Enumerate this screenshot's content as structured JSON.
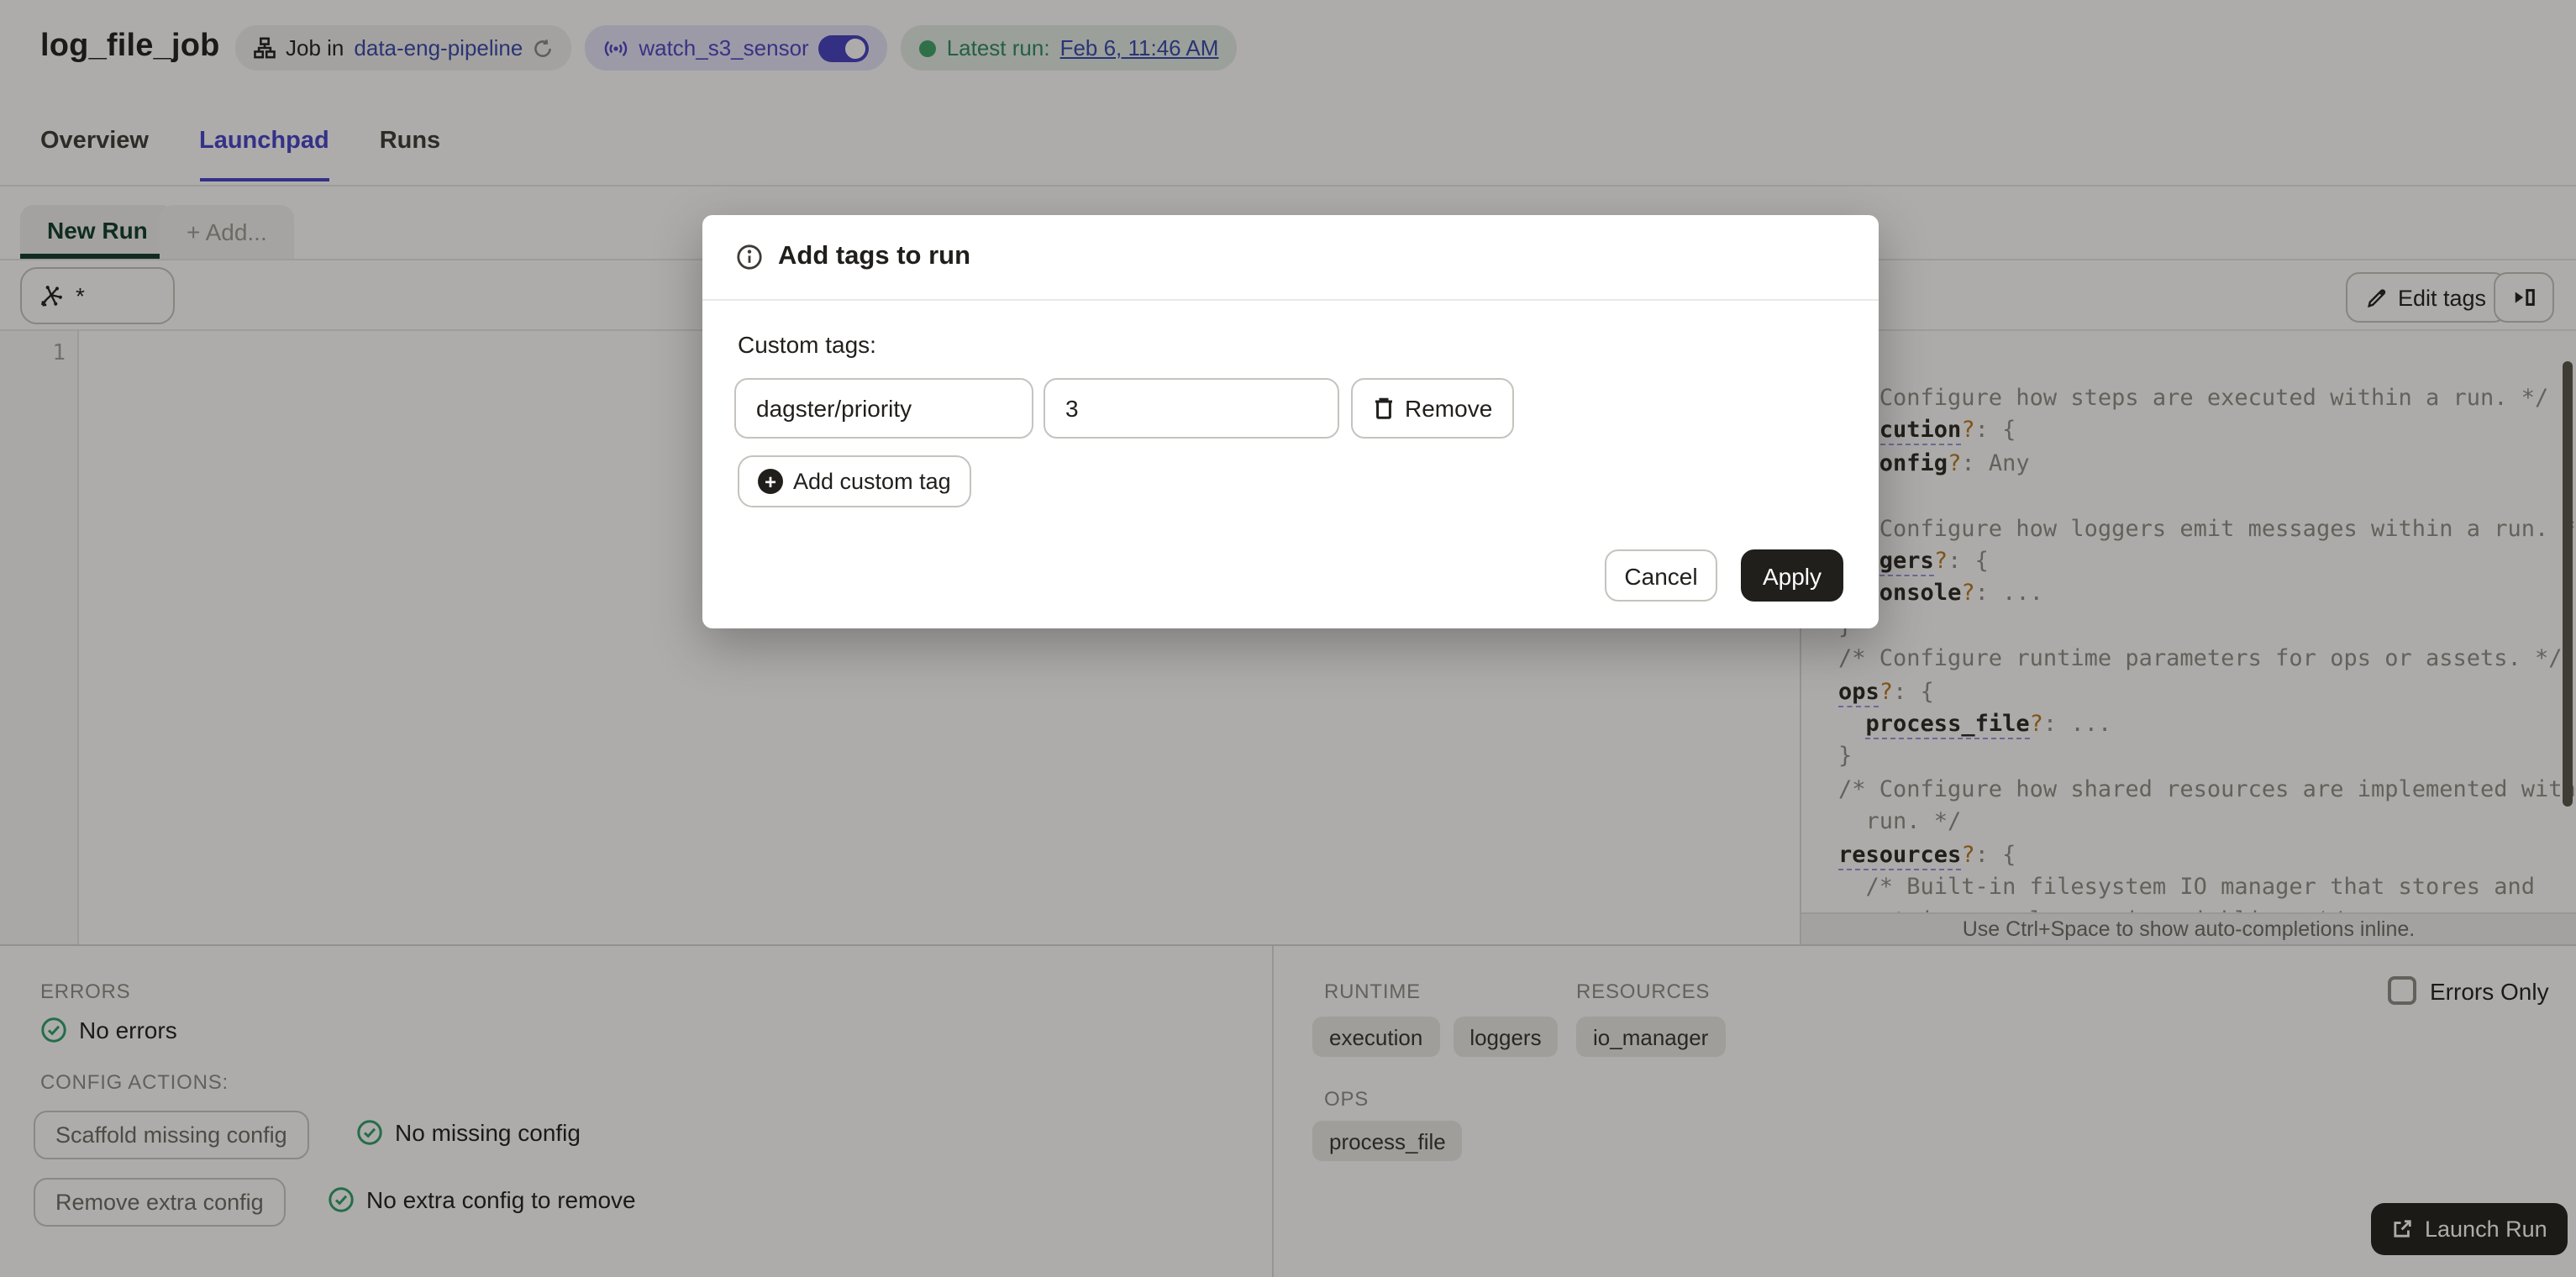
{
  "colors": {
    "accent_blue": "#4642C8",
    "link_blue": "#3647AD",
    "badge_sensor_bg": "#E6E3FA",
    "badge_sensor_text": "#4945C4",
    "green": "#2E9E68",
    "green_dot": "#3FA469",
    "dark": "#211F1C",
    "dark_green": "#0D3B2A",
    "schema_orange": "#B9771E",
    "schema_gray": "#908D86",
    "overlay": "rgba(20,18,15,0.35)"
  },
  "icons": {
    "job": "job-graph-icon",
    "refresh": "refresh-icon",
    "sensor": "sensor-broadcast-icon",
    "op_selector": "op-selector-icon",
    "edit": "pencil-icon",
    "panel": "collapse-panel-icon",
    "info": "info-icon",
    "trash": "trash-icon",
    "plus": "plus-circle-icon",
    "check": "check-circle-icon",
    "launch": "launch-icon"
  },
  "header": {
    "title": "log_file_job",
    "job_badge": {
      "prefix": "Job in",
      "repo_link": "data-eng-pipeline"
    },
    "sensor_badge": {
      "label": "watch_s3_sensor",
      "toggle_on": true
    },
    "latest_run_badge": {
      "label": "Latest run:",
      "value": "Feb 6, 11:46 AM"
    }
  },
  "tabs": {
    "overview": "Overview",
    "launchpad": "Launchpad",
    "runs": "Runs"
  },
  "launchpad": {
    "new_run_tab": "New Run",
    "add_tab": "+ Add...",
    "op_selector_value": "*",
    "edit_tags_button": "Edit tags",
    "editor": {
      "line_number": "1"
    },
    "hint_bar": "Use Ctrl+Space to show auto-completions inline.",
    "schema": {
      "lines": [
        [
          {
            "s": "c",
            "t": "/* Configure how steps are executed within a run. */"
          }
        ],
        [
          {
            "s": "ku",
            "t": "execution"
          },
          {
            "s": "q",
            "t": "?"
          },
          {
            "s": "p",
            "t": ": {"
          }
        ],
        [
          {
            "s": "p",
            "t": "  "
          },
          {
            "s": "k",
            "t": "config"
          },
          {
            "s": "q",
            "t": "?"
          },
          {
            "s": "p",
            "t": ": "
          },
          {
            "s": "v",
            "t": "Any"
          }
        ],
        [
          {
            "s": "p",
            "t": "}"
          }
        ],
        [
          {
            "s": "c",
            "t": "/* Configure how loggers emit messages within a run. */"
          }
        ],
        [
          {
            "s": "ku",
            "t": "loggers"
          },
          {
            "s": "q",
            "t": "?"
          },
          {
            "s": "p",
            "t": ": {"
          }
        ],
        [
          {
            "s": "p",
            "t": "  "
          },
          {
            "s": "k",
            "t": "console"
          },
          {
            "s": "q",
            "t": "?"
          },
          {
            "s": "p",
            "t": ": "
          },
          {
            "s": "v",
            "t": "..."
          }
        ],
        [
          {
            "s": "p",
            "t": "}"
          }
        ],
        [
          {
            "s": "c",
            "t": "/* Configure runtime parameters for ops or assets. */"
          }
        ],
        [
          {
            "s": "ku",
            "t": "ops"
          },
          {
            "s": "q",
            "t": "?"
          },
          {
            "s": "p",
            "t": ": {"
          }
        ],
        [
          {
            "s": "p",
            "t": "  "
          },
          {
            "s": "ku",
            "t": "process_file"
          },
          {
            "s": "q",
            "t": "?"
          },
          {
            "s": "p",
            "t": ": "
          },
          {
            "s": "v",
            "t": "..."
          }
        ],
        [
          {
            "s": "p",
            "t": "}"
          }
        ],
        [
          {
            "s": "c",
            "t": "/* Configure how shared resources are implemented within a"
          }
        ],
        [
          {
            "s": "c",
            "t": "  run. */"
          }
        ],
        [
          {
            "s": "ku",
            "t": "resources"
          },
          {
            "s": "q",
            "t": "?"
          },
          {
            "s": "p",
            "t": ": {"
          }
        ],
        [
          {
            "s": "c",
            "t": "  /* Built-in filesystem IO manager that stores and"
          }
        ],
        [
          {
            "s": "c",
            "t": "  retrieves values using pickling. */"
          }
        ]
      ]
    }
  },
  "bottom_left": {
    "errors_label": "ERRORS",
    "no_errors": "No errors",
    "config_actions_label": "CONFIG ACTIONS:",
    "scaffold_button": "Scaffold missing config",
    "no_missing": "No missing config",
    "remove_button": "Remove extra config",
    "no_extra": "No extra config to remove"
  },
  "bottom_right": {
    "runtime_label": "RUNTIME",
    "runtime_chips": [
      "execution",
      "loggers"
    ],
    "resources_label": "RESOURCES",
    "resources_chips": [
      "io_manager"
    ],
    "ops_label": "OPS",
    "ops_chips": [
      "process_file"
    ],
    "errors_only_label": "Errors Only",
    "launch_button": "Launch Run"
  },
  "modal": {
    "title": "Add tags to run",
    "custom_tags_label": "Custom tags:",
    "tag_key": "dagster/priority",
    "tag_value": "3",
    "remove_button": "Remove",
    "add_button": "Add custom tag",
    "cancel_button": "Cancel",
    "apply_button": "Apply"
  }
}
